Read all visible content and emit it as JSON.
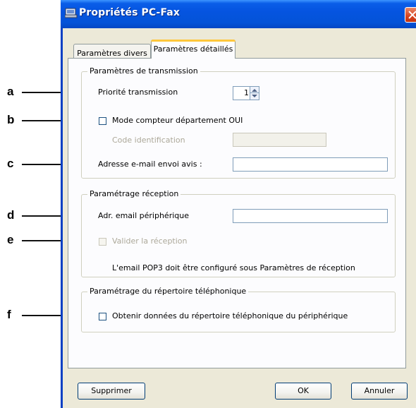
{
  "window": {
    "title": "Propriétés PC-Fax"
  },
  "tabs": [
    {
      "label": "Paramètres divers",
      "active": false
    },
    {
      "label": "Paramètres détaillés",
      "active": true
    }
  ],
  "transmission": {
    "legend": "Paramètres de transmission",
    "priority_label": "Priorité transmission",
    "priority_value": "1",
    "dept_counter_label": "Mode compteur département OUI",
    "dept_counter_checked": false,
    "id_code_label": "Code identification",
    "id_code_value": "",
    "notify_email_label": "Adresse e-mail envoi avis :",
    "notify_email_value": ""
  },
  "reception": {
    "legend": "Paramétrage réception",
    "device_email_label": "Adr. email périphérique",
    "device_email_value": "",
    "validate_label": "Valider la réception",
    "validate_checked": false,
    "pop3_note": "L'email POP3 doit être configuré sous Paramètres de réception"
  },
  "phonebook": {
    "legend": "Paramétrage du répertoire téléphonique",
    "get_data_label": "Obtenir données du répertoire téléphonique du périphérique",
    "get_data_checked": false
  },
  "buttons": {
    "delete": "Supprimer",
    "ok": "OK",
    "cancel": "Annuler"
  },
  "callouts": [
    "a",
    "b",
    "c",
    "d",
    "e",
    "f"
  ],
  "colors": {
    "titlebar": "#0554e0",
    "dialog_bg": "#ece9d8",
    "callout": "#111111"
  }
}
